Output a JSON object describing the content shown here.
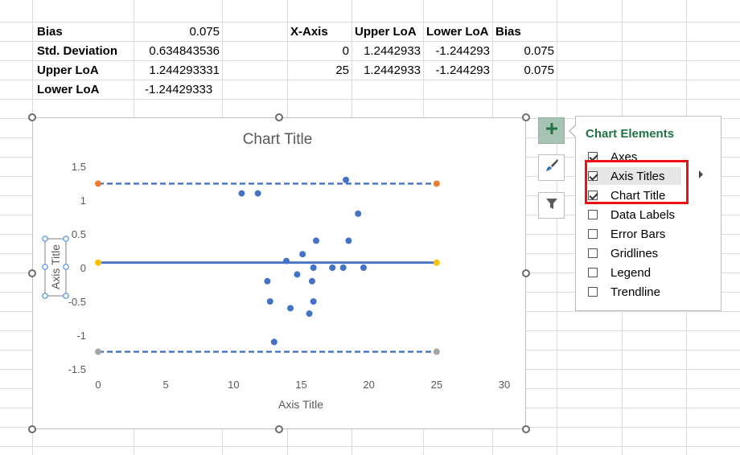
{
  "stats": {
    "rows": [
      {
        "label": "Bias",
        "value": "0.075"
      },
      {
        "label": "Std. Deviation",
        "value": "0.634843536"
      },
      {
        "label": "Upper LoA",
        "value": "1.244293331"
      },
      {
        "label": "Lower LoA",
        "value": "-1.24429333"
      }
    ]
  },
  "table": {
    "headers": [
      "X-Axis",
      "Upper LoA",
      "Lower LoA",
      "Bias"
    ],
    "rows": [
      [
        "0",
        "1.2442933",
        "-1.244293",
        "0.075"
      ],
      [
        "25",
        "1.2442933",
        "-1.244293",
        "0.075"
      ]
    ]
  },
  "chart": {
    "title": "Chart Title",
    "xlabel": "Axis Title",
    "ylabel": "Axis Title"
  },
  "chart_data": {
    "type": "scatter",
    "title": "Chart Title",
    "xlabel": "Axis Title",
    "ylabel": "Axis Title",
    "xlim": [
      0,
      30
    ],
    "ylim": [
      -1.5,
      1.5
    ],
    "xticks": [
      "0",
      "5",
      "10",
      "15",
      "20",
      "25",
      "30"
    ],
    "yticks": [
      "1.5",
      "1",
      "0.5",
      "0",
      "-0.5",
      "-1",
      "-1.5"
    ],
    "grid": false,
    "series": [
      {
        "type": "scatter",
        "color": "#4472c4",
        "points": [
          [
            10.6,
            1.1
          ],
          [
            11.8,
            1.1
          ],
          [
            18.3,
            1.3
          ],
          [
            19.2,
            0.8
          ],
          [
            16.1,
            0.4
          ],
          [
            18.5,
            0.4
          ],
          [
            15.1,
            0.2
          ],
          [
            13.9,
            0.1
          ],
          [
            15.9,
            0.0
          ],
          [
            17.3,
            0.0
          ],
          [
            18.1,
            0.0
          ],
          [
            19.6,
            0.0
          ],
          [
            14.7,
            -0.1
          ],
          [
            12.5,
            -0.2
          ],
          [
            15.8,
            -0.2
          ],
          [
            12.7,
            -0.5
          ],
          [
            15.9,
            -0.5
          ],
          [
            14.2,
            -0.6
          ],
          [
            15.6,
            -0.68
          ],
          [
            13.0,
            -1.1
          ]
        ]
      },
      {
        "type": "line",
        "style": "dashed",
        "color": "#4472c4",
        "marker_color": "#ed7d31",
        "x": [
          0,
          25
        ],
        "y": [
          1.244293331,
          1.244293331
        ]
      },
      {
        "type": "line",
        "style": "solid",
        "color": "#4472c4",
        "marker_color": "#ffc000",
        "x": [
          0,
          25
        ],
        "y": [
          0.075,
          0.075
        ]
      },
      {
        "type": "line",
        "style": "dashed",
        "color": "#4472c4",
        "marker_color": "#a5a5a5",
        "x": [
          0,
          25
        ],
        "y": [
          -1.24429333,
          -1.24429333
        ]
      }
    ]
  },
  "panel": {
    "title": "Chart Elements",
    "options": [
      {
        "label": "Axes",
        "checked": true
      },
      {
        "label": "Axis Titles",
        "checked": true
      },
      {
        "label": "Chart Title",
        "checked": true
      },
      {
        "label": "Data Labels",
        "checked": false
      },
      {
        "label": "Error Bars",
        "checked": false
      },
      {
        "label": "Gridlines",
        "checked": false
      },
      {
        "label": "Legend",
        "checked": false
      },
      {
        "label": "Trendline",
        "checked": false
      }
    ]
  },
  "colors": {
    "accent_green": "#217346",
    "highlight_red": "#ee1111",
    "series_blue": "#4472c4"
  },
  "icons": [
    "plus-icon",
    "paintbrush-icon",
    "filter-icon",
    "chevron-right-icon"
  ]
}
